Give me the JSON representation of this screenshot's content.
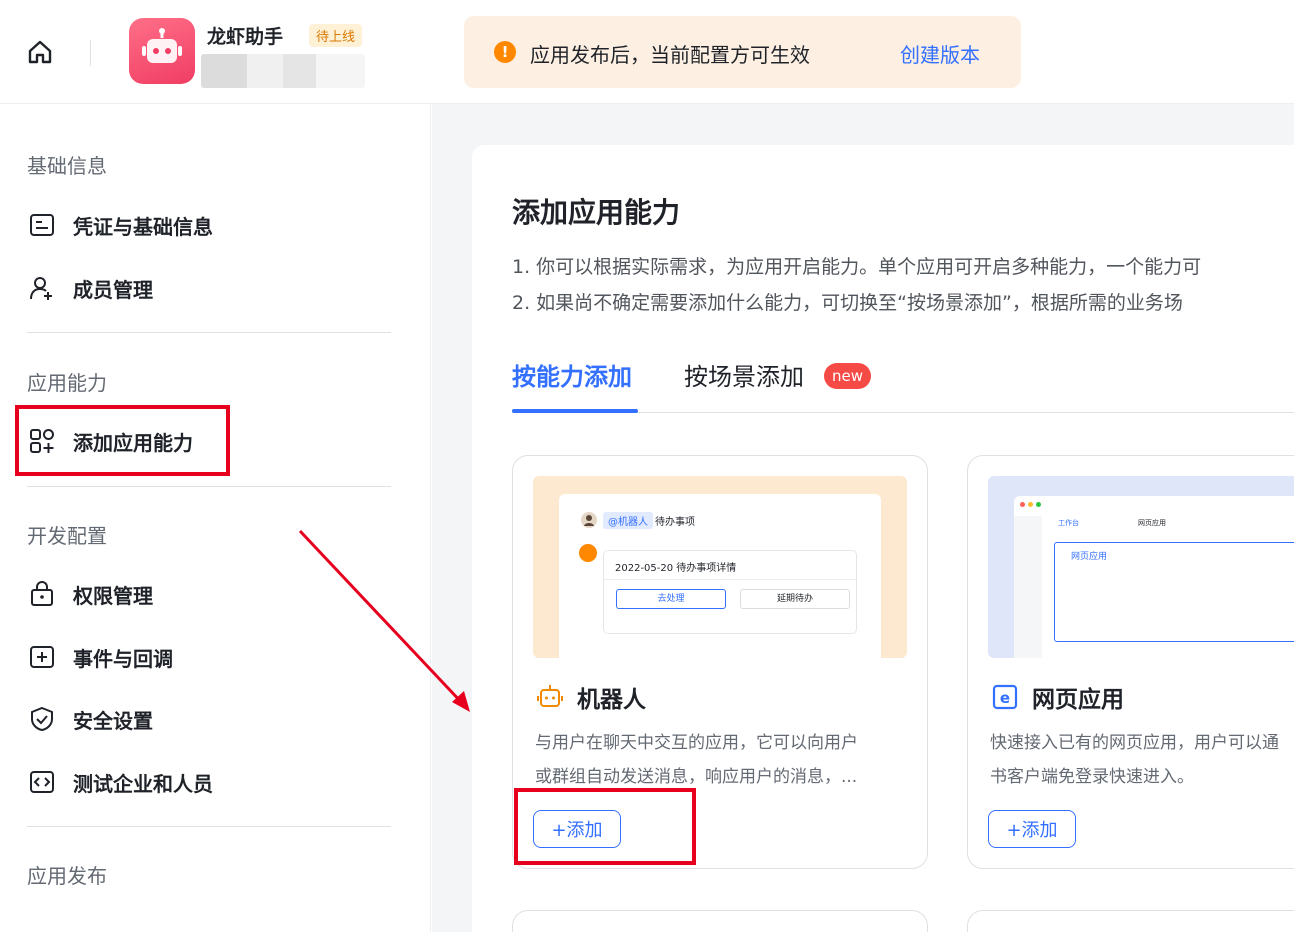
{
  "header": {
    "app_name": "龙虾助手",
    "app_status_badge": "待上线",
    "notice_text": "应用发布后，当前配置方可生效",
    "notice_link": "创建版本",
    "notice_icon": "!"
  },
  "sidebar": {
    "sections": [
      {
        "title": "基础信息",
        "items": [
          "凭证与基础信息",
          "成员管理"
        ]
      },
      {
        "title": "应用能力",
        "items": [
          "添加应用能力"
        ]
      },
      {
        "title": "开发配置",
        "items": [
          "权限管理",
          "事件与回调",
          "安全设置",
          "测试企业和人员"
        ]
      },
      {
        "title": "应用发布",
        "items": []
      }
    ]
  },
  "main": {
    "title": "添加应用能力",
    "desc_1": "1. 你可以根据实际需求，为应用开启能力。单个应用可开启多种能力，一个能力可",
    "desc_2": "2. 如果尚不确定需要添加什么能力，可切换至“按场景添加”，根据所需的业务场",
    "tabs": [
      {
        "label": "按能力添加",
        "active": true
      },
      {
        "label": "按场景添加",
        "badge": "new"
      }
    ],
    "features": [
      {
        "title": "机器人",
        "icon": "robot-icon",
        "desc_1": "与用户在聊天中交互的应用，它可以向用户",
        "desc_2": "或群组自动发送消息，响应用户的消息，...",
        "button": "+添加",
        "preview": {
          "tag": "@机器人",
          "tag_text": "待办事项",
          "message": "2022-05-20 待办事项详情",
          "btn_1": "去处理",
          "btn_2": "延期待办"
        }
      },
      {
        "title": "网页应用",
        "icon": "web-app-icon",
        "desc_1": "快速接入已有的网页应用，用户可以通",
        "desc_2": "书客户端免登录快速进入。",
        "button": "+添加",
        "preview": {
          "tab_1": "工作台",
          "tab_2": "网页应用",
          "item": "网页应用"
        }
      }
    ]
  },
  "colors": {
    "accent": "#3370ff",
    "highlight": "#e6001e",
    "notice_bg": "#fdf0e2",
    "warn": "#ff8800",
    "badge_red": "#f54a45"
  }
}
